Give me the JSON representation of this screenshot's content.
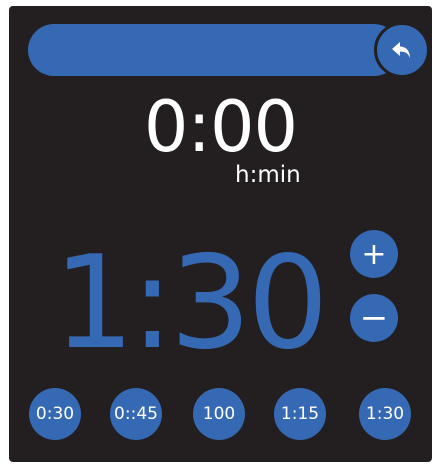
{
  "colors": {
    "background": "#231f20",
    "accent": "#3569b4",
    "text": "#ffffff"
  },
  "header": {
    "back_icon": "undo-arrow-icon"
  },
  "elapsed": {
    "value": "0:00",
    "unit": "h:min"
  },
  "setpoint": {
    "value": "1:30",
    "plus_label": "+",
    "minus_label": "−"
  },
  "presets": [
    {
      "label": "0:30"
    },
    {
      "label": "0::45"
    },
    {
      "label": "100"
    },
    {
      "label": "1:15"
    },
    {
      "label": "1:30"
    }
  ]
}
